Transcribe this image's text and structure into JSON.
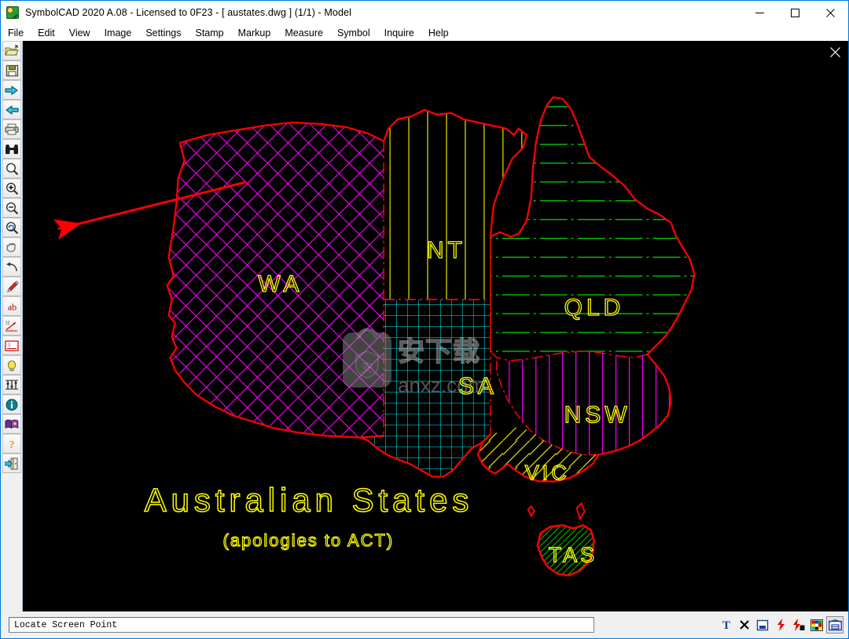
{
  "window": {
    "title": "SymbolCAD 2020 A.08 - Licensed to 0F23  -  [ austates.dwg ] (1/1)  -  Model",
    "app_icon": "symbolcad-app-icon",
    "minimize_label": "–",
    "maximize_label": "☐",
    "close_label": "✕"
  },
  "menubar": {
    "items": [
      {
        "label": "File"
      },
      {
        "label": "Edit"
      },
      {
        "label": "View"
      },
      {
        "label": "Image"
      },
      {
        "label": "Settings"
      },
      {
        "label": "Stamp"
      },
      {
        "label": "Markup"
      },
      {
        "label": "Measure"
      },
      {
        "label": "Symbol"
      },
      {
        "label": "Inquire"
      },
      {
        "label": "Help"
      }
    ]
  },
  "toolbar": {
    "items": [
      {
        "name": "open-folder-icon",
        "tip": "Open"
      },
      {
        "name": "save-disk-icon",
        "tip": "Save"
      },
      {
        "name": "arrow-right-icon",
        "tip": "Next"
      },
      {
        "name": "arrow-left-icon",
        "tip": "Previous"
      },
      {
        "name": "printer-icon",
        "tip": "Print"
      },
      {
        "name": "binoculars-icon",
        "tip": "Find"
      },
      {
        "name": "magnifier-icon",
        "tip": "Zoom Window"
      },
      {
        "name": "zoom-in-icon",
        "tip": "Zoom In"
      },
      {
        "name": "zoom-out-icon",
        "tip": "Zoom Out"
      },
      {
        "name": "zoom-previous-icon",
        "tip": "Zoom Previous"
      },
      {
        "name": "pan-hand-icon",
        "tip": "Pan"
      },
      {
        "name": "undo-arrow-icon",
        "tip": "Undo"
      },
      {
        "name": "pencil-icon",
        "tip": "Draw"
      },
      {
        "name": "text-ab-icon",
        "tip": "Text"
      },
      {
        "name": "dimension-icon",
        "tip": "Dimension"
      },
      {
        "name": "line-number-icon",
        "tip": "Annotate"
      },
      {
        "name": "lightbulb-icon",
        "tip": "Layers"
      },
      {
        "name": "settings-sliders-icon",
        "tip": "Properties"
      },
      {
        "name": "info-icon",
        "tip": "Info"
      },
      {
        "name": "book-icon",
        "tip": "Reference"
      },
      {
        "name": "help-question-icon",
        "tip": "Help"
      },
      {
        "name": "exit-door-icon",
        "tip": "Exit"
      }
    ]
  },
  "canvas": {
    "close_label": "✕",
    "background_color": "#000000",
    "drawing": {
      "title": "Australian States",
      "subtitle": "(apologies to ACT)",
      "title_color": "#ffff00",
      "outline_color": "#ff0000",
      "states": [
        {
          "code": "WA",
          "label": "WA",
          "hatch": "diagonal-crosshatch",
          "hatch_color": "#ff00ff",
          "label_color": "#ffff00"
        },
        {
          "code": "NT",
          "label": "NT",
          "hatch": "vertical-lines",
          "hatch_color": "#ffff00",
          "label_color": "#ffff00"
        },
        {
          "code": "QLD",
          "label": "QLD",
          "hatch": "horizontal-dashdot",
          "hatch_color": "#00e000",
          "label_color": "#ffff00"
        },
        {
          "code": "SA",
          "label": "SA",
          "hatch": "square-grid",
          "hatch_color": "#00ffff",
          "label_color": "#ffff00"
        },
        {
          "code": "NSW",
          "label": "NSW",
          "hatch": "vertical-lines",
          "hatch_color": "#ff00ff",
          "label_color": "#ffff00"
        },
        {
          "code": "VIC",
          "label": "VIC",
          "hatch": "diagonal-lines",
          "hatch_color": "#ffff00",
          "label_color": "#ffff00"
        },
        {
          "code": "TAS",
          "label": "TAS",
          "hatch": "diagonal-lines",
          "hatch_color": "#00e000",
          "label_color": "#ffff00"
        }
      ],
      "annotation": {
        "name": "red-leader-arrow",
        "color": "#ff0000"
      }
    },
    "watermark": {
      "site": "anxz.com",
      "logo": "shield-bag-logo"
    }
  },
  "statusbar": {
    "message": "Locate Screen Point",
    "icons": [
      {
        "name": "text-tool-icon",
        "glyph": "T"
      },
      {
        "name": "delete-x-icon",
        "glyph": "×"
      },
      {
        "name": "window-panel-icon",
        "glyph": "▣"
      },
      {
        "name": "lightning-icon",
        "glyph": "⚡"
      },
      {
        "name": "lightning-lock-icon",
        "glyph": "⚡"
      },
      {
        "name": "color-palette-icon",
        "glyph": "▦"
      },
      {
        "name": "layout-frame-icon",
        "glyph": "⌸"
      }
    ]
  }
}
